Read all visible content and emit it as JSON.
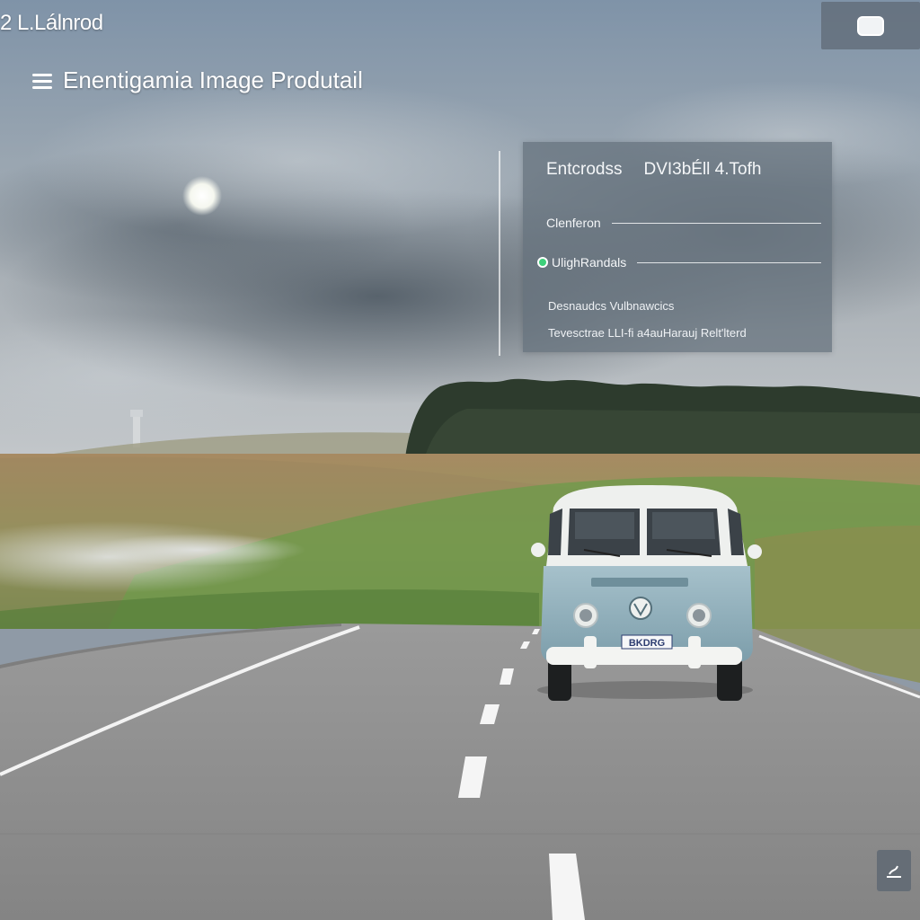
{
  "window": {
    "title": "2 L.Lálnrod"
  },
  "app": {
    "header": "Enentigamia Image Produtail"
  },
  "panel": {
    "header_left": "Entcrodss",
    "header_right": "DVI3bÉll 4.Tofh",
    "field1_label": "Clenferon",
    "field2_label": "UlighRandals",
    "line1": "Desnaudcs Vulbnawcics",
    "line2": "Tevesctrae LLI-fi a4auHarauj Relt'lterd"
  },
  "van": {
    "plate": "BKDRG"
  },
  "icons": {
    "menu": "menu-icon",
    "window": "window-icon",
    "corner": "signature-icon",
    "toggle": "toggle-dot-icon"
  },
  "colors": {
    "panel_bg": "#64707c",
    "toggle": "#3dd07a",
    "van_body": "#8fb0bd",
    "road": "#8c8c8c"
  }
}
